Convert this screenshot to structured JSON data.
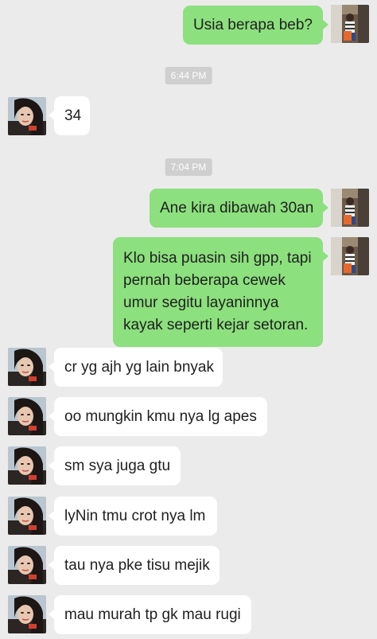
{
  "timestamps": [
    "6:44 PM",
    "7:04 PM"
  ],
  "messages": [
    {
      "from": "me",
      "text": "Usia berapa beb?"
    },
    {
      "from": "her",
      "text": "34"
    },
    {
      "from": "me",
      "text": "Ane kira dibawah 30an"
    },
    {
      "from": "me",
      "text": "Klo bisa puasin sih gpp, tapi pernah beberapa cewek umur segitu layaninnya kayak seperti kejar setoran."
    },
    {
      "from": "her",
      "text": "cr yg ajh yg lain bnyak"
    },
    {
      "from": "her",
      "text": "oo mungkin kmu nya lg apes"
    },
    {
      "from": "her",
      "text": "sm sya juga gtu"
    },
    {
      "from": "her",
      "text": "lyNin tmu crot nya lm"
    },
    {
      "from": "her",
      "text": "tau nya pke tisu mejik"
    },
    {
      "from": "her",
      "text": "mau murah tp gk mau rugi"
    }
  ],
  "colors": {
    "background": "#ebebeb",
    "outgoing_bubble": "#8ce07e",
    "incoming_bubble": "#ffffff",
    "timestamp_pill": "#cfcfcf"
  }
}
